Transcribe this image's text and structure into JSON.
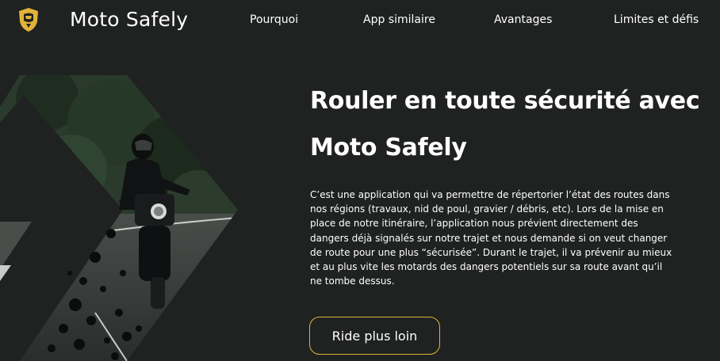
{
  "brand": {
    "name": "Moto Safely",
    "logo_icon": "helmet-shield-icon",
    "accent": "#e2b33a"
  },
  "nav": {
    "items": [
      {
        "label": "Pourquoi"
      },
      {
        "label": "App similaire"
      },
      {
        "label": "Avantages"
      },
      {
        "label": "Limites et défis"
      }
    ]
  },
  "hero": {
    "title_line1": "Rouler en toute sécurité avec",
    "title_line2": "Moto Safely",
    "description": "C’est une application qui va permettre de répertorier l’état des routes dans nos régions (travaux, nid de poul, gravier / débris, etc). Lors de la mise en place de notre itinéraire, l’application nous prévient directement des dangers déjà signalés sur notre trajet et nous demande si on veut changer de route pour une plus “sécurisée”. Durant le trajet, il va prévenir au mieux et au plus vite les motards des dangers potentiels sur sa route avant qu’il ne tombe dessus.",
    "cta_label": "Ride plus loin"
  },
  "colors": {
    "background": "#1f2220",
    "text": "#ffffff",
    "button_border": "#e2b33a"
  }
}
